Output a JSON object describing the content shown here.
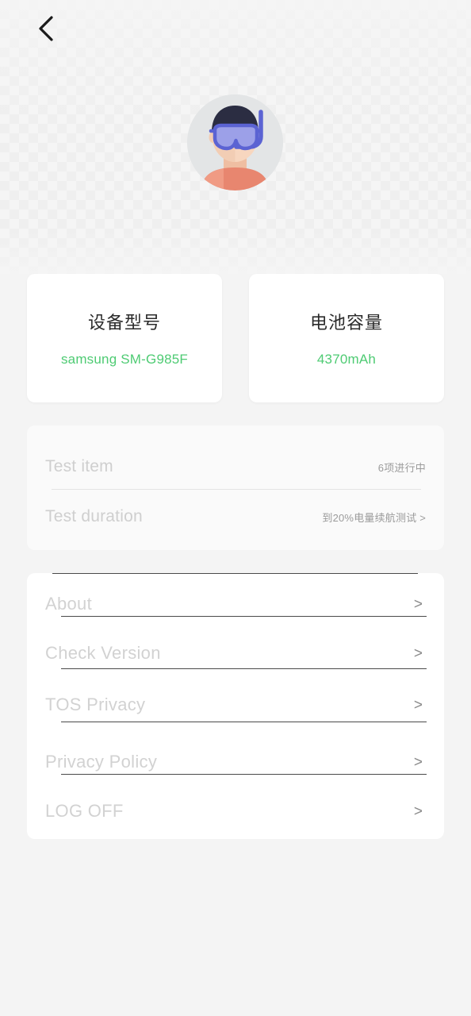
{
  "header": {
    "back_icon": "chevron-left-icon"
  },
  "profile": {
    "avatar_icon": "diver-avatar-icon",
    "avatar_bg": "#e3e5e6",
    "skin_color": "#f2cdb4",
    "hair_color": "#2b2d42",
    "mask_color": "#5b63d3",
    "shirt_color": "#e8866f"
  },
  "info_cards": [
    {
      "title": "设备型号",
      "value": "samsung SM-G985F"
    },
    {
      "title": "电池容量",
      "value": "4370mAh"
    }
  ],
  "test_card": {
    "rows": [
      {
        "label": "Test item",
        "value": "6项进行中"
      },
      {
        "label": "Test duration",
        "value": "到20%电量续航测试 >"
      }
    ]
  },
  "menu": {
    "items": [
      {
        "label": "About",
        "chevron": ">"
      },
      {
        "label": "Check Version",
        "chevron": ">"
      },
      {
        "label": "TOS Privacy",
        "chevron": ">"
      },
      {
        "label": "Privacy Policy",
        "chevron": ">"
      },
      {
        "label": "LOG OFF",
        "chevron": ">"
      }
    ]
  },
  "colors": {
    "accent_green": "#4ECB73",
    "page_bg": "#f4f4f4",
    "card_bg": "#ffffff",
    "muted_label": "#d2d2d2"
  }
}
